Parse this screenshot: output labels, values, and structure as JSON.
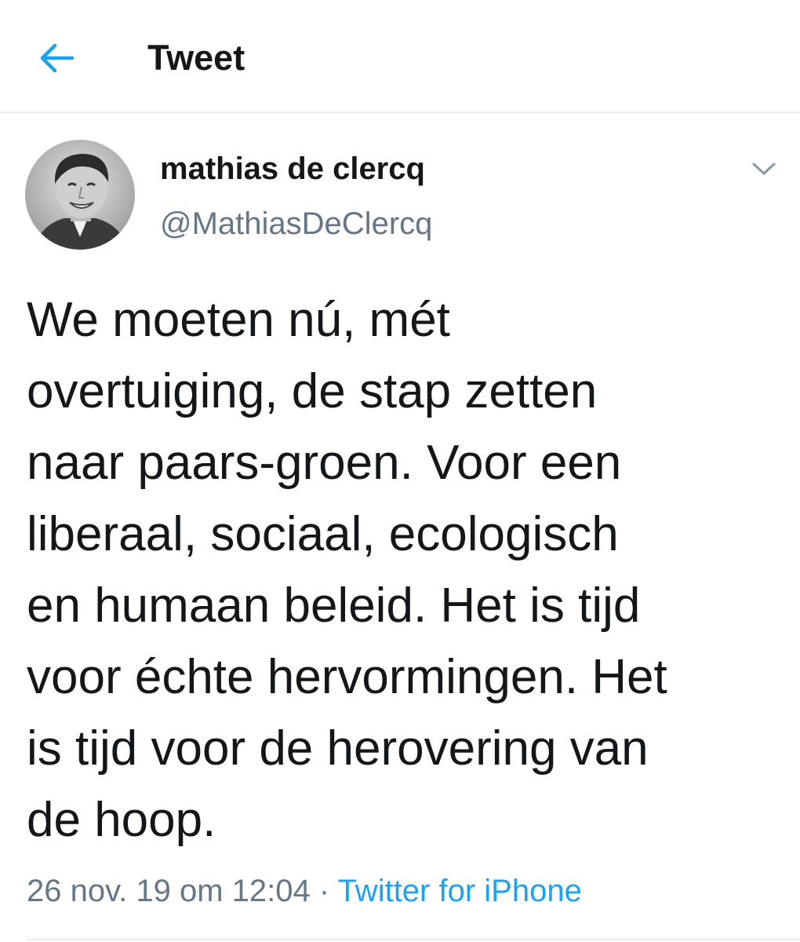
{
  "header": {
    "title": "Tweet",
    "back_icon": "arrow-left-icon",
    "accent_color": "#1da1f2"
  },
  "tweet": {
    "author": {
      "name": "mathias de clercq",
      "handle": "@MathiasDeClercq",
      "avatar": "grayscale-portrait-photo"
    },
    "menu_icon": "chevron-down-icon",
    "text_lines": [
      "We moeten nú, mét",
      "overtuiging, de stap zetten",
      "naar paars-groen. Voor een",
      "liberaal, sociaal, ecologisch",
      "en humaan beleid. Het is tijd",
      "voor échte hervormingen. Het",
      "is tijd voor de herovering van",
      "de hoop."
    ],
    "timestamp": "26 nov. 19 om 12:04",
    "separator": " · ",
    "source": "Twitter for iPhone"
  },
  "colors": {
    "text_primary": "#14171a",
    "text_secondary": "#657786",
    "link": "#1da1f2",
    "divider": "#e6ecf0"
  }
}
